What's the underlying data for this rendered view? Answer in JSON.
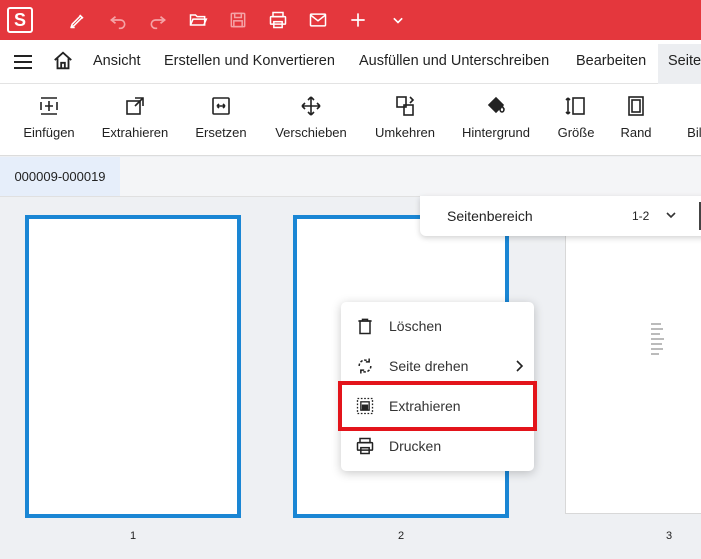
{
  "app": {
    "logo_letter": "S",
    "accent_color": "#e4373d",
    "quick_icons": [
      "pen-icon",
      "undo-icon",
      "redo-icon",
      "open-folder-icon",
      "save-icon",
      "print-icon",
      "mail-icon",
      "plus-icon",
      "chevron-down-icon"
    ]
  },
  "menubar": {
    "items": [
      "Ansicht",
      "Erstellen und Konvertieren",
      "Ausfüllen und Unterschreiben",
      "Bearbeiten",
      "Seite"
    ]
  },
  "toolbar": {
    "tools": [
      {
        "label": "Einfügen",
        "icon": "insert-icon"
      },
      {
        "label": "Extrahieren",
        "icon": "extract-icon"
      },
      {
        "label": "Ersetzen",
        "icon": "replace-icon"
      },
      {
        "label": "Verschieben",
        "icon": "move-icon"
      },
      {
        "label": "Umkehren",
        "icon": "reverse-icon"
      },
      {
        "label": "Hintergrund",
        "icon": "paint-bucket-icon"
      },
      {
        "label": "Größe",
        "icon": "size-icon"
      },
      {
        "label": "Rand",
        "icon": "margin-icon"
      },
      {
        "label": "Bild",
        "icon": "image-icon"
      }
    ]
  },
  "document_tab": {
    "label": "000009-000019"
  },
  "page_range": {
    "label": "Seitenbereich",
    "value": "1-2"
  },
  "pages": [
    {
      "number": "1",
      "selected": true
    },
    {
      "number": "2",
      "selected": true
    },
    {
      "number": "3",
      "selected": false
    }
  ],
  "context_menu": {
    "items": [
      {
        "label": "Löschen",
        "icon": "trash-icon"
      },
      {
        "label": "Seite drehen",
        "icon": "rotate-icon"
      },
      {
        "label": "Extrahieren",
        "icon": "extract-page-icon"
      },
      {
        "label": "Drucken",
        "icon": "print-icon"
      }
    ],
    "highlighted": "Extrahieren",
    "highlight_color": "#e3141b"
  },
  "selection_color": "#1a86d4"
}
